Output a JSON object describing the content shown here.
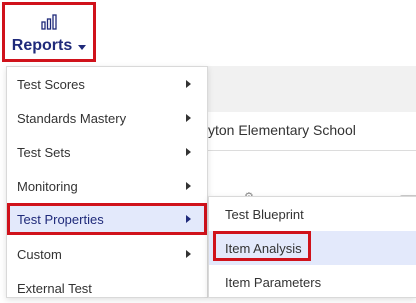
{
  "nav": {
    "reports_label": "Reports",
    "reports_icon": "bar-chart-icon"
  },
  "background": {
    "school_name": "yton Elementary School"
  },
  "menu": {
    "items": [
      {
        "label": "Test Scores",
        "has_submenu": true
      },
      {
        "label": "Standards Mastery",
        "has_submenu": true
      },
      {
        "label": "Test Sets",
        "has_submenu": true
      },
      {
        "label": "Monitoring",
        "has_submenu": true
      },
      {
        "label": "Test Properties",
        "has_submenu": true,
        "active": true
      },
      {
        "label": "Custom",
        "has_submenu": true
      },
      {
        "label": "External Test",
        "has_submenu": false
      }
    ]
  },
  "submenu": {
    "items": [
      {
        "label": "Test Blueprint"
      },
      {
        "label": "Item Analysis",
        "highlighted": true
      },
      {
        "label": "Item Parameters"
      }
    ]
  },
  "colors": {
    "accent": "#1f2a7a",
    "highlight_border": "#d0121b",
    "active_bg": "#e3e9fb"
  }
}
